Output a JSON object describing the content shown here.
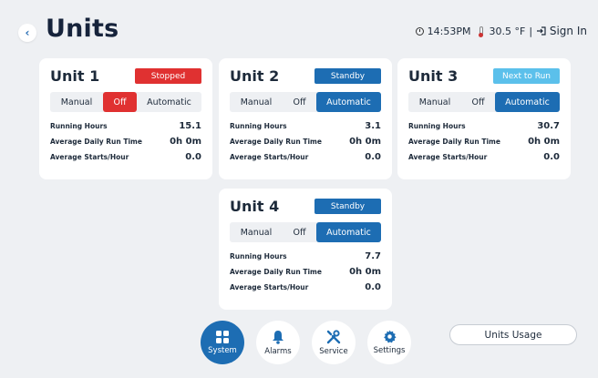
{
  "header": {
    "title": "Units",
    "time": "14:53PM",
    "temperature": "30.5 °F",
    "separator": "|",
    "signin_label": "Sign In"
  },
  "units": [
    {
      "name": "Unit 1",
      "status": "Stopped",
      "status_color": "#e03131",
      "mode_manual": "Manual",
      "mode_off": "Off",
      "mode_auto": "Automatic",
      "active_mode": "Off",
      "running_hours_label": "Running Hours",
      "running_hours": "15.1",
      "avg_daily_label": "Average Daily Run Time",
      "avg_daily": "0h 0m",
      "avg_starts_label": "Average Starts/Hour",
      "avg_starts": "0.0"
    },
    {
      "name": "Unit 2",
      "status": "Standby",
      "status_color": "#1d6db3",
      "mode_manual": "Manual",
      "mode_off": "Off",
      "mode_auto": "Automatic",
      "active_mode": "Automatic",
      "running_hours_label": "Running Hours",
      "running_hours": "3.1",
      "avg_daily_label": "Average Daily Run Time",
      "avg_daily": "0h 0m",
      "avg_starts_label": "Average Starts/Hour",
      "avg_starts": "0.0"
    },
    {
      "name": "Unit 3",
      "status": "Next to Run",
      "status_color": "#5bc0eb",
      "mode_manual": "Manual",
      "mode_off": "Off",
      "mode_auto": "Automatic",
      "active_mode": "Automatic",
      "running_hours_label": "Running Hours",
      "running_hours": "30.7",
      "avg_daily_label": "Average Daily Run Time",
      "avg_daily": "0h 0m",
      "avg_starts_label": "Average Starts/Hour",
      "avg_starts": "0.0"
    },
    {
      "name": "Unit 4",
      "status": "Standby",
      "status_color": "#1d6db3",
      "mode_manual": "Manual",
      "mode_off": "Off",
      "mode_auto": "Automatic",
      "active_mode": "Automatic",
      "running_hours_label": "Running Hours",
      "running_hours": "7.7",
      "avg_daily_label": "Average Daily Run Time",
      "avg_daily": "0h 0m",
      "avg_starts_label": "Average Starts/Hour",
      "avg_starts": "0.0"
    }
  ],
  "nav": {
    "system": "System",
    "alarms": "Alarms",
    "service": "Service",
    "settings": "Settings",
    "active": "System"
  },
  "usage_button": "Units Usage",
  "colors": {
    "accent": "#1d6db3",
    "stopped": "#e03131",
    "next": "#5bc0eb",
    "background": "#eef0f3"
  }
}
